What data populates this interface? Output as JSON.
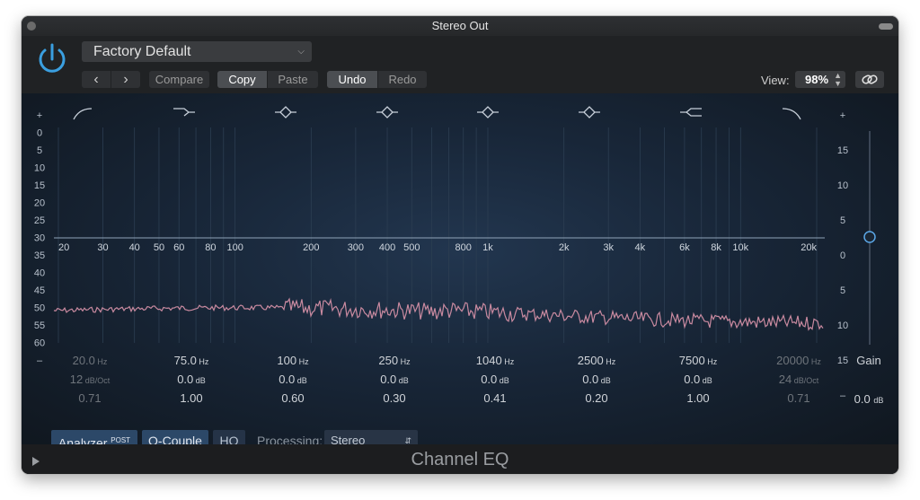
{
  "window": {
    "title": "Stereo Out"
  },
  "header": {
    "preset": "Factory Default",
    "nav_prev": "‹",
    "nav_next": "›",
    "compare": "Compare",
    "copy": "Copy",
    "paste": "Paste",
    "undo": "Undo",
    "redo": "Redo",
    "view_label": "View:",
    "view_value": "98%"
  },
  "graph": {
    "left_db_labels": [
      "+",
      "0",
      "5",
      "10",
      "15",
      "20",
      "25",
      "30",
      "35",
      "40",
      "45",
      "50",
      "55",
      "60",
      "–"
    ],
    "right_db_labels": [
      "+",
      "15",
      "10",
      "5",
      "0",
      "5",
      "10",
      "15",
      "–"
    ],
    "freq_labels": [
      "20",
      "30",
      "40",
      "50",
      "60",
      "80",
      "100",
      "200",
      "300",
      "400",
      "500",
      "800",
      "1k",
      "2k",
      "3k",
      "4k",
      "6k",
      "8k",
      "10k",
      "20k"
    ],
    "band_icons": [
      "low-cut-icon",
      "low-shelf-icon",
      "bell-icon",
      "bell-icon",
      "bell-icon",
      "bell-icon",
      "high-shelf-icon",
      "high-cut-icon"
    ],
    "accent_color": "#3a9fe0",
    "analyzer_color": "#c98aa0"
  },
  "bands": [
    {
      "freq": "20.0",
      "freq_unit": "Hz",
      "gain": "12",
      "gain_unit": "dB/Oct",
      "q": "0.71",
      "active": false
    },
    {
      "freq": "75.0",
      "freq_unit": "Hz",
      "gain": "0.0",
      "gain_unit": "dB",
      "q": "1.00",
      "active": true
    },
    {
      "freq": "100",
      "freq_unit": "Hz",
      "gain": "0.0",
      "gain_unit": "dB",
      "q": "0.60",
      "active": true
    },
    {
      "freq": "250",
      "freq_unit": "Hz",
      "gain": "0.0",
      "gain_unit": "dB",
      "q": "0.30",
      "active": true
    },
    {
      "freq": "1040",
      "freq_unit": "Hz",
      "gain": "0.0",
      "gain_unit": "dB",
      "q": "0.41",
      "active": true
    },
    {
      "freq": "2500",
      "freq_unit": "Hz",
      "gain": "0.0",
      "gain_unit": "dB",
      "q": "0.20",
      "active": true
    },
    {
      "freq": "7500",
      "freq_unit": "Hz",
      "gain": "0.0",
      "gain_unit": "dB",
      "q": "1.00",
      "active": true
    },
    {
      "freq": "20000",
      "freq_unit": "Hz",
      "gain": "24",
      "gain_unit": "dB/Oct",
      "q": "0.71",
      "active": false
    }
  ],
  "gain": {
    "label": "Gain",
    "value": "0.0",
    "unit": "dB"
  },
  "bottom": {
    "analyzer": "Analyzer",
    "analyzer_sup": "POST",
    "qcouple": "Q-Couple",
    "hq": "HQ",
    "processing_label": "Processing:",
    "processing_value": "Stereo"
  },
  "footer": {
    "plugin_name": "Channel EQ"
  }
}
